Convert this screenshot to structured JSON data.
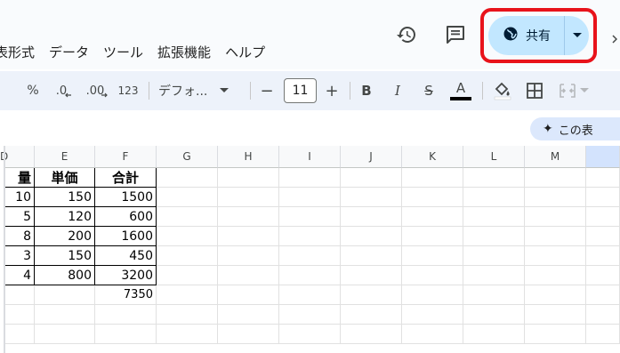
{
  "menu": {
    "items": [
      "表形式",
      "データ",
      "ツール",
      "拡張機能",
      "ヘルプ"
    ]
  },
  "header": {
    "share_label": "共有"
  },
  "toolbar": {
    "percent": "%",
    "decimal_decrease": ".0",
    "decimal_increase": ".00",
    "number_format": "123",
    "font_name": "デフォ...",
    "font_size": "11",
    "minus": "−",
    "plus": "+",
    "bold": "B",
    "italic": "I",
    "strike": "S",
    "text_color": "A"
  },
  "ai_chip": {
    "label": "この表"
  },
  "columns": [
    "D",
    "E",
    "F",
    "G",
    "H",
    "I",
    "J",
    "K",
    "L",
    "M"
  ],
  "table": {
    "headers": [
      "量",
      "単価",
      "合計"
    ],
    "rows": [
      [
        "10",
        "150",
        "1500"
      ],
      [
        "5",
        "120",
        "600"
      ],
      [
        "8",
        "200",
        "1600"
      ],
      [
        "3",
        "150",
        "450"
      ],
      [
        "4",
        "800",
        "3200"
      ]
    ],
    "grand_total": "7350"
  },
  "colors": {
    "share_bg": "#c2e7ff",
    "highlight_border": "#e8131b",
    "toolbar_bg": "#edf2fa",
    "text_color_underline": "#000000"
  }
}
